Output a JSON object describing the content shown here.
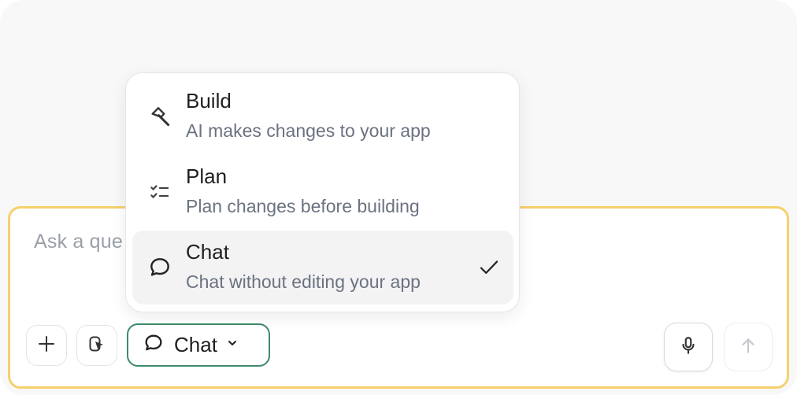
{
  "composer": {
    "placeholder": "Ask a que"
  },
  "mode_button": {
    "label": "Chat"
  },
  "menu": {
    "items": [
      {
        "title": "Build",
        "description": "AI makes changes to your app",
        "icon": "hammer-icon",
        "selected": false
      },
      {
        "title": "Plan",
        "description": "Plan changes before building",
        "icon": "checklist-icon",
        "selected": false
      },
      {
        "title": "Chat",
        "description": "Chat without editing your app",
        "icon": "chat-bubble-icon",
        "selected": true
      }
    ]
  },
  "colors": {
    "composer_border": "#f5d06b",
    "mode_border": "#3f8a6b",
    "selected_bg": "#f3f3f4",
    "muted_text": "#6b7280"
  }
}
